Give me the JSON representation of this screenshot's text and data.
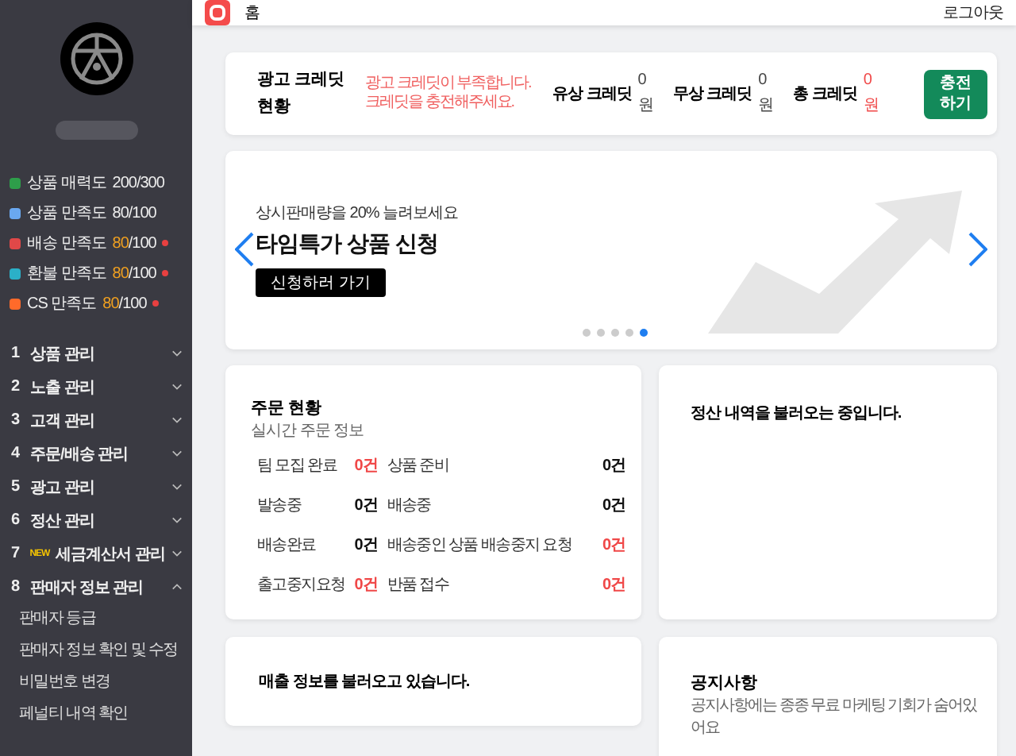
{
  "sidebar": {
    "metrics": [
      {
        "kind": "attract",
        "label": "상품 매력도",
        "value": "200",
        "max": "/300",
        "warning": false
      },
      {
        "kind": "doc",
        "label": "상품 만족도",
        "value": "80",
        "max": "/100",
        "warning": false
      },
      {
        "kind": "truck",
        "label": "배송 만족도",
        "value": "80",
        "max": "/100",
        "warning": true
      },
      {
        "kind": "refund",
        "label": "환불 만족도",
        "value": "80",
        "max": "/100",
        "warning": true
      },
      {
        "kind": "cs",
        "label": "CS 만족도",
        "value": "80",
        "max": "/100",
        "warning": true
      }
    ],
    "menu": [
      {
        "number": "1",
        "label": "상품 관리",
        "expanded": false
      },
      {
        "number": "2",
        "label": "노출 관리",
        "expanded": false
      },
      {
        "number": "3",
        "label": "고객 관리",
        "expanded": false
      },
      {
        "number": "4",
        "label": "주문/배송 관리",
        "expanded": false
      },
      {
        "number": "5",
        "label": "광고 관리",
        "expanded": false
      },
      {
        "number": "6",
        "label": "정산 관리",
        "expanded": false
      },
      {
        "number": "7",
        "badge": "NEW",
        "label": "세금계산서 관리",
        "expanded": false
      },
      {
        "number": "8",
        "label": "판매자 정보 관리",
        "expanded": true,
        "children": [
          {
            "label": "판매자 등급"
          },
          {
            "label": "판매자 정보 확인 및 수정"
          },
          {
            "label": "비밀번호 변경"
          },
          {
            "label": "페널티 내역 확인"
          }
        ]
      }
    ]
  },
  "top_bar": {
    "title": "홈",
    "logout": "로그아웃"
  },
  "credit": {
    "title": "광고 크레딧 현황",
    "warning": "광고 크레딧이 부족합니다. 크레딧을 충전해주세요.",
    "items": [
      {
        "label": "유상 크레딧",
        "value": "0원",
        "alert": false
      },
      {
        "label": "무상 크레딧",
        "value": "0원",
        "alert": false
      },
      {
        "label": "총 크레딧",
        "value": "0원",
        "alert": true
      }
    ],
    "button": "충전하기"
  },
  "banner": {
    "subtitle": "상시판매량을 20% 늘려보세요",
    "title": "타임특가 상품 신청",
    "button": "신청하러 가기",
    "dots": [
      {
        "selected": false
      },
      {
        "selected": false
      },
      {
        "selected": false
      },
      {
        "selected": false
      },
      {
        "selected": true
      }
    ]
  },
  "orders": {
    "title": "주문 현황",
    "subtitle": "실시간 주문 정보",
    "items": [
      {
        "label": "팀 모집 완료",
        "count": "0건",
        "alert": true
      },
      {
        "label": "상품 준비",
        "count": "0건",
        "alert": false
      },
      {
        "label": "발송중",
        "count": "0건",
        "alert": false
      },
      {
        "label": "배송중",
        "count": "0건",
        "alert": false
      },
      {
        "label": "배송완료",
        "count": "0건",
        "alert": false
      },
      {
        "label": "배송중인 상품 배송중지 요청",
        "count": "0건",
        "alert": true
      },
      {
        "label": "출고중지요청",
        "count": "0건",
        "alert": true
      },
      {
        "label": "반품 접수",
        "count": "0건",
        "alert": true
      }
    ]
  },
  "settlement": {
    "message": "정산 내역을 불러오는 중입니다."
  },
  "sales": {
    "message": "매출 정보를 불러오고 있습니다."
  },
  "notice": {
    "title": "공지사항",
    "subtitle": "공지사항에는 종종 무료 마케팅 기회가 숨어있어요"
  }
}
